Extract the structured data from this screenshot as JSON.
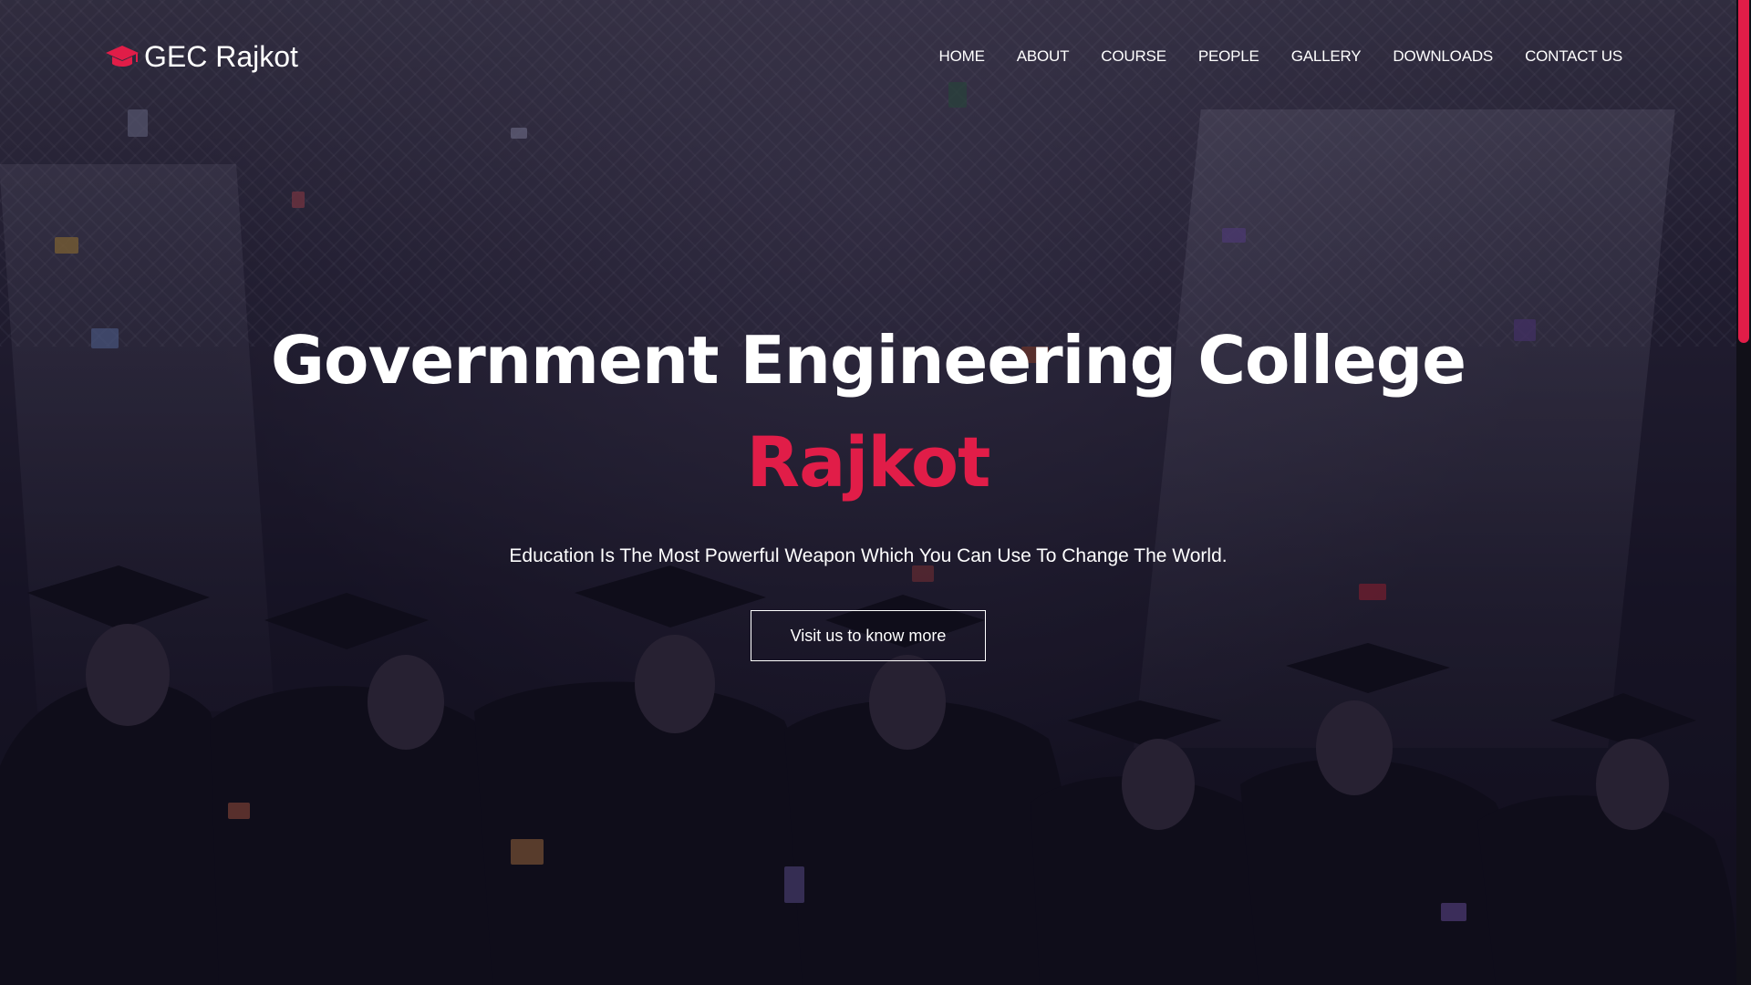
{
  "brand": {
    "name": "GEC Rajkot",
    "icon": "graduation-cap-icon",
    "icon_color": "#e11d48"
  },
  "nav": {
    "items": [
      {
        "label": "HOME"
      },
      {
        "label": "ABOUT"
      },
      {
        "label": "COURSE"
      },
      {
        "label": "PEOPLE"
      },
      {
        "label": "GALLERY"
      },
      {
        "label": "DOWNLOADS"
      },
      {
        "label": "CONTACT US"
      }
    ]
  },
  "hero": {
    "title": "Government Engineering College",
    "title_accent": "Rajkot",
    "tagline": "Education Is The Most Powerful Weapon Which You Can Use To Change The World.",
    "cta_label": "Visit us to know more"
  },
  "colors": {
    "accent": "#e11d48",
    "text": "#ffffff",
    "overlay": "#120f1c"
  }
}
